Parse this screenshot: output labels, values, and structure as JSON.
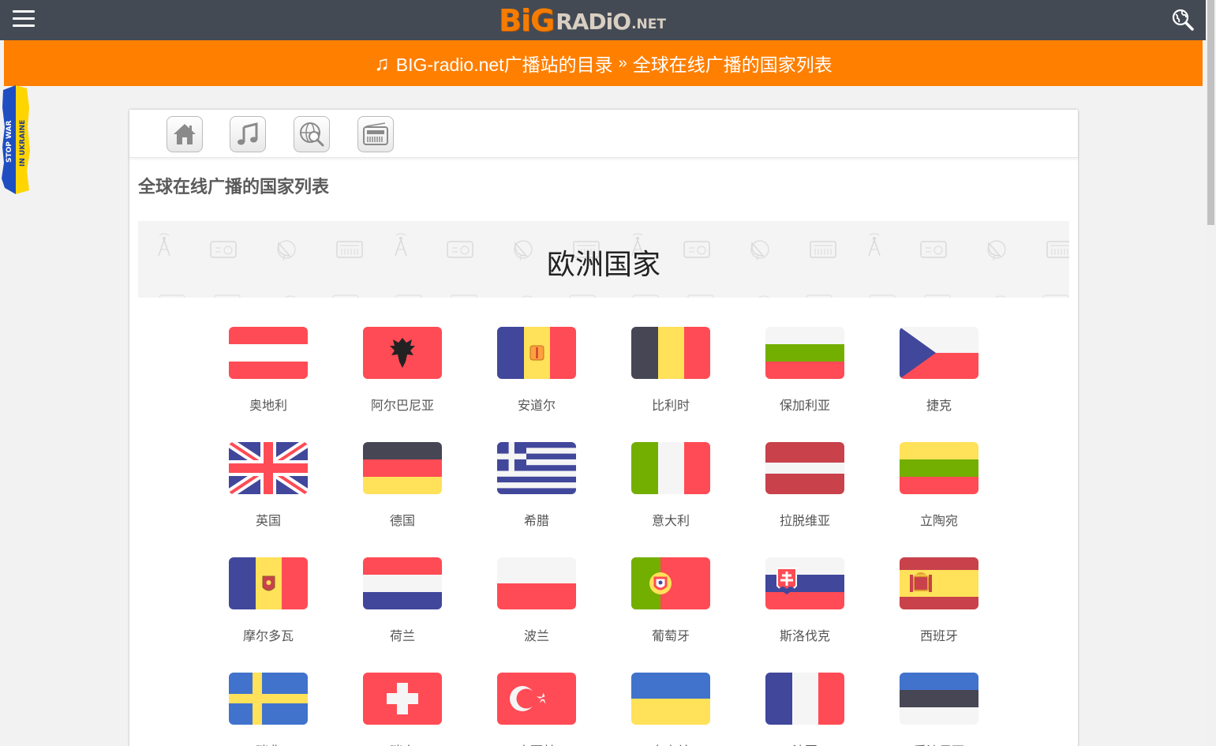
{
  "header": {
    "logo": {
      "big": "BiG",
      "radio": "RADiO",
      "net": ".NET"
    },
    "menu_icon": "hamburger-menu-icon",
    "search_icon": "globe-search-icon"
  },
  "breadcrumb": {
    "home_link": "BIG-radio.net广播站的目录",
    "separator": "»",
    "current": "全球在线广播的国家列表"
  },
  "ukraine_badge": {
    "line1": "STOP WAR",
    "line2": "IN UKRAINE"
  },
  "toolbar": {
    "icons": [
      "home-icon",
      "music-note-icon",
      "globe-search-icon",
      "radio-icon"
    ]
  },
  "page": {
    "title": "全球在线广播的国家列表",
    "region_title": "欧洲国家"
  },
  "countries": [
    {
      "name": "奥地利",
      "flag": "at"
    },
    {
      "name": "阿尔巴尼亚",
      "flag": "al"
    },
    {
      "name": "安道尔",
      "flag": "ad"
    },
    {
      "name": "比利时",
      "flag": "be"
    },
    {
      "name": "保加利亚",
      "flag": "bg"
    },
    {
      "name": "捷克",
      "flag": "cz"
    },
    {
      "name": "英国",
      "flag": "gb"
    },
    {
      "name": "德国",
      "flag": "de"
    },
    {
      "name": "希腊",
      "flag": "gr"
    },
    {
      "name": "意大利",
      "flag": "it"
    },
    {
      "name": "拉脱维亚",
      "flag": "lv"
    },
    {
      "name": "立陶宛",
      "flag": "lt"
    },
    {
      "name": "摩尔多瓦",
      "flag": "md"
    },
    {
      "name": "荷兰",
      "flag": "nl"
    },
    {
      "name": "波兰",
      "flag": "pl"
    },
    {
      "name": "葡萄牙",
      "flag": "pt"
    },
    {
      "name": "斯洛伐克",
      "flag": "sk"
    },
    {
      "name": "西班牙",
      "flag": "es"
    },
    {
      "name": "瑞典",
      "flag": "se"
    },
    {
      "name": "瑞士",
      "flag": "ch"
    },
    {
      "name": "土耳其",
      "flag": "tr"
    },
    {
      "name": "乌克兰",
      "flag": "ua"
    },
    {
      "name": "法国",
      "flag": "fr"
    },
    {
      "name": "爱沙尼亚",
      "flag": "ee"
    }
  ],
  "colors": {
    "topbar": "#434a54",
    "accent": "#ff7f00",
    "logo_orange": "#f57c00"
  }
}
